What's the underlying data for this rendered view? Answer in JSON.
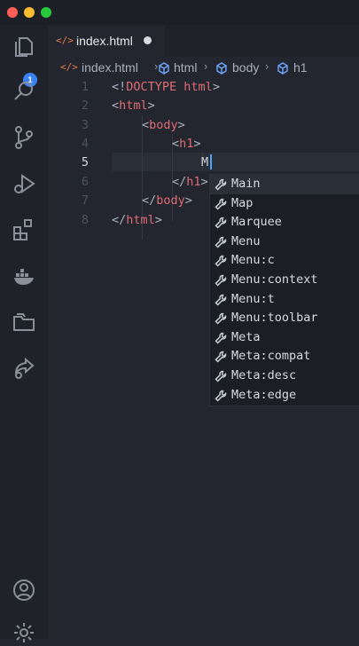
{
  "window": {
    "controls": [
      "close",
      "minimize",
      "zoom"
    ],
    "colors": {
      "close": "#ff5f57",
      "minimize": "#febc2e",
      "zoom": "#28c840"
    }
  },
  "activity_bar": {
    "items": [
      "explorer-icon",
      "search-icon",
      "source-control-icon",
      "run-debug-icon",
      "extensions-icon",
      "docker-icon",
      "remote-explorer-icon",
      "live-share-icon",
      "account-icon",
      "settings-icon"
    ],
    "explorer_badge": "1"
  },
  "tab": {
    "icon": "</>",
    "label": "index.html"
  },
  "breadcrumb": {
    "file": "index.html",
    "items": [
      "html",
      "body",
      "h1"
    ]
  },
  "editor": {
    "line_numbers": [
      "1",
      "2",
      "3",
      "4",
      "5",
      "6",
      "7",
      "8"
    ],
    "active_line": "5",
    "lines": {
      "l1": {
        "open": "<!",
        "kw": "DOCTYPE",
        "rest": " html",
        "close": ">"
      },
      "l2": {
        "open": "<",
        "tag": "html",
        "close": ">"
      },
      "l3": {
        "open": "<",
        "tag": "body",
        "close": ">"
      },
      "l4": {
        "open": "<",
        "tag": "h1",
        "close": ">"
      },
      "l5": {
        "text": "M"
      },
      "l6": {
        "open": "</",
        "tag": "h1",
        "close": ">"
      },
      "l7": {
        "open": "</",
        "tag": "body",
        "close": ">"
      },
      "l8": {
        "open": "</",
        "tag": "html",
        "close": ">"
      }
    }
  },
  "suggestions": {
    "icon": "wrench-icon",
    "selected": "Main",
    "items": [
      "Main",
      "Map",
      "Marquee",
      "Menu",
      "Menu:c",
      "Menu:context",
      "Menu:t",
      "Menu:toolbar",
      "Meta",
      "Meta:compat",
      "Meta:desc",
      "Meta:edge"
    ]
  }
}
